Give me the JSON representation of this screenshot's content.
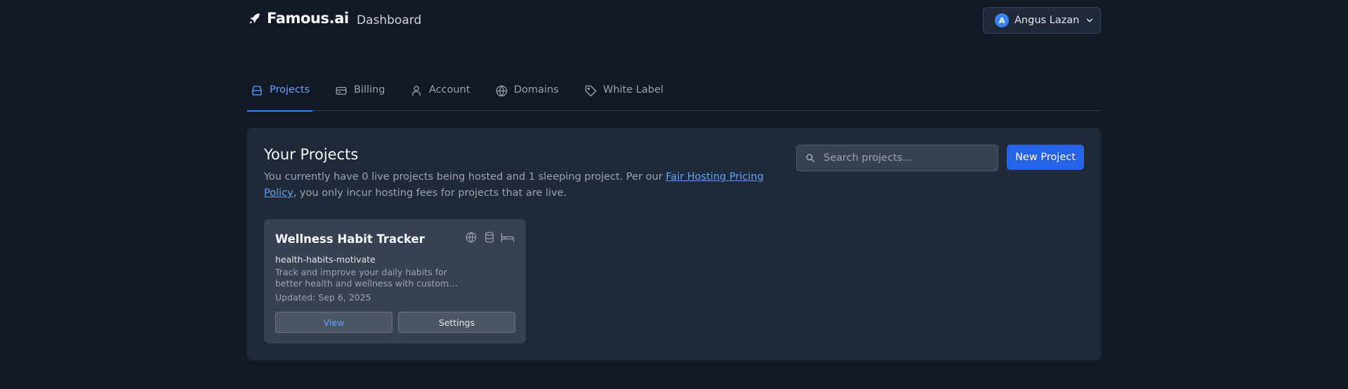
{
  "header": {
    "brand": "Famous.ai",
    "title": "Dashboard",
    "user": {
      "initial": "A",
      "name": "Angus Lazan"
    }
  },
  "tabs": [
    {
      "label": "Projects",
      "icon": "inbox-icon",
      "active": true
    },
    {
      "label": "Billing",
      "icon": "credit-card-icon",
      "active": false
    },
    {
      "label": "Account",
      "icon": "user-icon",
      "active": false
    },
    {
      "label": "Domains",
      "icon": "globe-icon",
      "active": false
    },
    {
      "label": "White Label",
      "icon": "tag-icon",
      "active": false
    }
  ],
  "projects_panel": {
    "title": "Your Projects",
    "desc_before": "You currently have 0 live projects being hosted and 1 sleeping project. Per our ",
    "policy_link": "Fair Hosting Pricing Policy",
    "desc_after": ", you only incur hosting fees for projects that are live.",
    "search_placeholder": "Search projects...",
    "new_project_label": "New Project"
  },
  "project": {
    "name": "Wellness Habit Tracker",
    "slug": "health-habits-motivate",
    "description": "Track and improve your daily habits for better health and wellness with custom routines and reminders.",
    "updated": "Updated: Sep 6, 2025",
    "status_icons": [
      "globe-icon",
      "database-icon",
      "bed-icon"
    ],
    "view_label": "View",
    "settings_label": "Settings"
  },
  "colors": {
    "background": "#121826",
    "panel": "#1f2937",
    "accent": "#2563eb",
    "active_tab": "#60a5fa"
  }
}
